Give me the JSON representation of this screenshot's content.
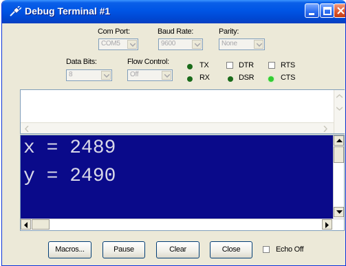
{
  "window": {
    "title": "Debug Terminal #1"
  },
  "settings": {
    "com_port": {
      "label": "Com Port:",
      "value": "COM5"
    },
    "baud_rate": {
      "label": "Baud Rate:",
      "value": "9600"
    },
    "parity": {
      "label": "Parity:",
      "value": "None"
    },
    "data_bits": {
      "label": "Data Bits:",
      "value": "8"
    },
    "flow_control": {
      "label": "Flow Control:",
      "value": "Off"
    }
  },
  "indicators": {
    "tx": {
      "label": "TX",
      "color": "#1a6b1a"
    },
    "rx": {
      "label": "RX",
      "color": "#1a6b1a"
    },
    "dsr": {
      "label": "DSR",
      "color": "#1a6b1a"
    },
    "cts": {
      "label": "CTS",
      "color": "#33cc33"
    },
    "dtr": {
      "label": "DTR",
      "checked": false
    },
    "rts": {
      "label": "RTS",
      "checked": false
    }
  },
  "receive": {
    "lines": [
      "x = 2489",
      "y = 2490"
    ],
    "background": "#0a0a8a"
  },
  "buttons": {
    "macros": "Macros...",
    "pause": "Pause",
    "clear": "Clear",
    "close": "Close",
    "echo_off": "Echo Off"
  },
  "echo_off_checked": false
}
